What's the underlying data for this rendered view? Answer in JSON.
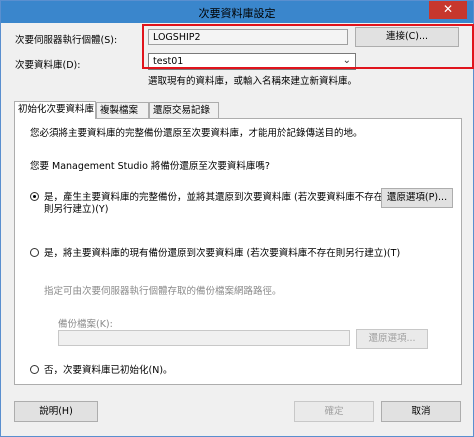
{
  "window": {
    "title": "次要資料庫設定",
    "close_glyph": "✕"
  },
  "server": {
    "label": "次要伺服器執行個體(S):",
    "value": "LOGSHIP2",
    "connect_button": "連接(C)..."
  },
  "database": {
    "label": "次要資料庫(D):",
    "value": "test01",
    "hint": "選取現有的資料庫，或輸入名稱來建立新資料庫。"
  },
  "tabs": [
    {
      "label": "初始化次要資料庫",
      "active": true
    },
    {
      "label": "複製檔案",
      "active": false
    },
    {
      "label": "還原交易記錄",
      "active": false
    }
  ],
  "init": {
    "intro": "您必須將主要資料庫的完整備份還原至次要資料庫，才能用於記錄傳送目的地。",
    "question": "您要 Management Studio 將備份還原至次要資料庫嗎?",
    "option1_line1": "是，產生主要資料庫的完整備份，並將其還原到次要資料庫 (若次要資料庫不存在",
    "option1_line2": "則另行建立)(Y)",
    "restore_options_button": "還原選項(P)...",
    "option2": "是，將主要資料庫的現有備份還原到次要資料庫 (若次要資料庫不存在則另行建立)(T)",
    "backup_path_hint": "指定可由次要伺服器執行個體存取的備份檔案網路路徑。",
    "backup_file_label": "備份檔案(K):",
    "backup_file_value": "",
    "restore_options_button2": "還原選項...",
    "option3": "否，次要資料庫已初始化(N)。",
    "selected_option": 1
  },
  "footer": {
    "help_button": "說明(H)",
    "ok_button": "確定",
    "cancel_button": "取消"
  }
}
